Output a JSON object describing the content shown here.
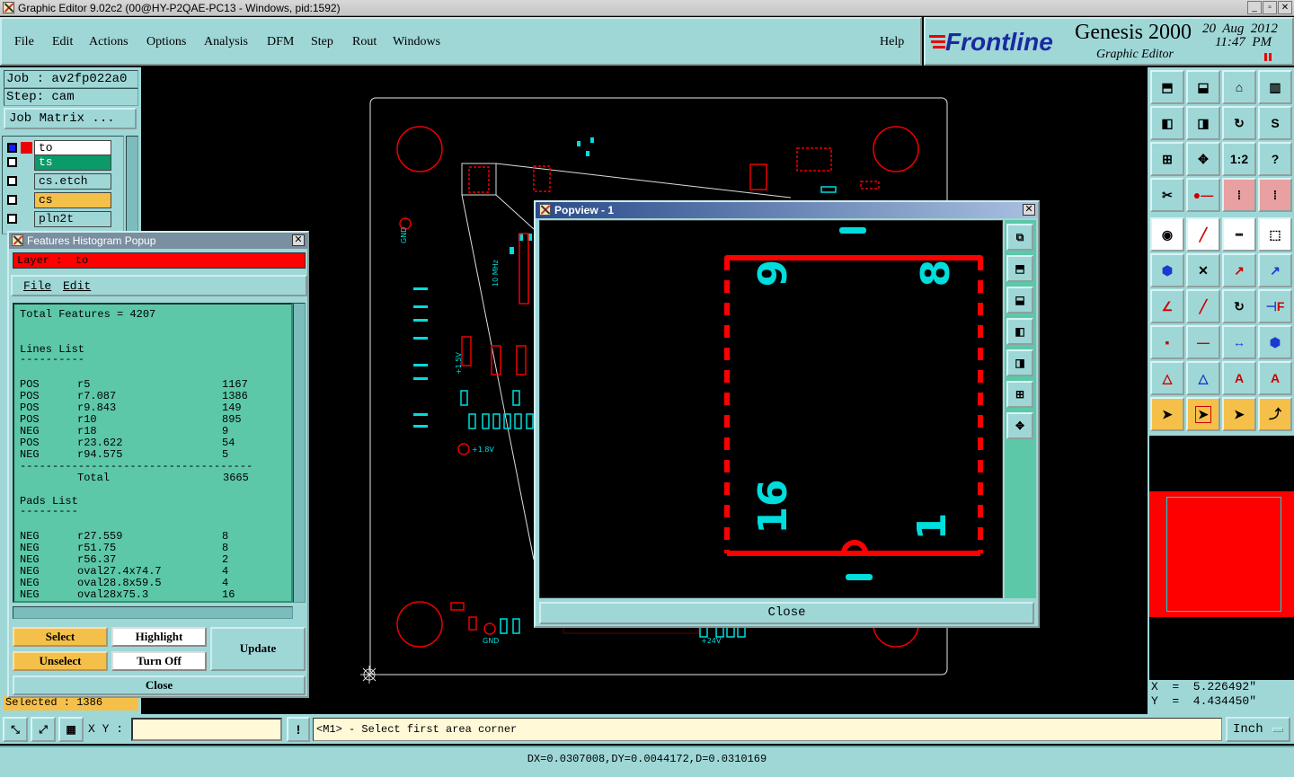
{
  "window": {
    "title": "Graphic Editor 9.02c2 (00@HY-P2QAE-PC13 - Windows, pid:1592)"
  },
  "menu": {
    "items": [
      "File",
      "Edit",
      "Actions",
      "Options",
      "Analysis",
      "DFM",
      "Step",
      "Rout",
      "Windows"
    ],
    "help": "Help"
  },
  "brand": {
    "logo": "Frontline",
    "product": "Genesis 2000",
    "subtitle": "Graphic Editor",
    "date": "20  Aug  2012",
    "time": "11:47  PM"
  },
  "job": {
    "job_label": "Job : av2fp022a0",
    "step_label": "Step: cam",
    "matrix_button": "Job Matrix ..."
  },
  "layers": [
    {
      "name": "to",
      "color": "#ffffff"
    },
    {
      "name": "ts",
      "color": "#0b9a6a"
    },
    {
      "name": "cs.etch",
      "color": "#9fd7d7"
    },
    {
      "name": "cs",
      "color": "#f5c04a"
    },
    {
      "name": "pln2t",
      "color": "#9fd7d7"
    }
  ],
  "histogram": {
    "title": "Features Histogram Popup",
    "layer_label": "Layer :  to",
    "menu": [
      "File",
      "Edit"
    ],
    "total_features": "Total Features = 4207",
    "lines_header": "Lines List",
    "lines": [
      {
        "pol": "POS",
        "sym": "r5",
        "count": "1167"
      },
      {
        "pol": "POS",
        "sym": "r7.087",
        "count": "1386"
      },
      {
        "pol": "POS",
        "sym": "r9.843",
        "count": "149"
      },
      {
        "pol": "POS",
        "sym": "r10",
        "count": "895"
      },
      {
        "pol": "NEG",
        "sym": "r18",
        "count": "9"
      },
      {
        "pol": "POS",
        "sym": "r23.622",
        "count": "54"
      },
      {
        "pol": "NEG",
        "sym": "r94.575",
        "count": "5"
      }
    ],
    "total_label": "Total",
    "total_value": "3665",
    "pads_header": "Pads List",
    "pads": [
      {
        "pol": "NEG",
        "sym": "r27.559",
        "count": "8"
      },
      {
        "pol": "NEG",
        "sym": "r51.75",
        "count": "8"
      },
      {
        "pol": "NEG",
        "sym": "r56.37",
        "count": "2"
      },
      {
        "pol": "NEG",
        "sym": "oval27.4x74.7",
        "count": "4"
      },
      {
        "pol": "NEG",
        "sym": "oval28.8x59.5",
        "count": "4"
      },
      {
        "pol": "NEG",
        "sym": "oval28x75.3",
        "count": "16"
      }
    ],
    "buttons": {
      "select": "Select",
      "highlight": "Highlight",
      "update": "Update",
      "unselect": "Unselect",
      "turn_off": "Turn Off",
      "close": "Close"
    }
  },
  "selected_status": "Selected : 1386",
  "popview": {
    "title": "Popview - 1",
    "close": "Close",
    "labels": [
      "9",
      "8",
      "16",
      "1"
    ]
  },
  "board_labels": [
    "GND",
    "10 MHz",
    "+1.5V",
    "+1.8V",
    "GND",
    "+24V"
  ],
  "coords": {
    "x": "X  =  5.226492\"",
    "y": "Y  =  4.434450\""
  },
  "bottom": {
    "xy_label": "X Y :",
    "xy_value": "",
    "prompt": "<M1> - Select first area corner",
    "units": "Inch",
    "measure": "DX=0.0307008,DY=0.0044172,D=0.0310169"
  },
  "colors": {
    "panel": "#9fd7d7",
    "red": "#ff0000",
    "cyan": "#00e5e5",
    "orange": "#f5c04a"
  },
  "icons": [
    "zoom-home-icon",
    "zoom-in-icon",
    "zoom-out-icon",
    "one-to-one-icon",
    "help-icon",
    "snap-icon",
    "pointer-icon"
  ]
}
